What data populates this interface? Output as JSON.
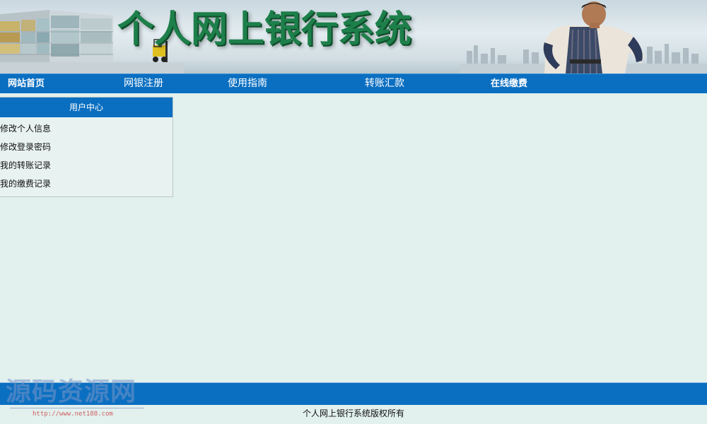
{
  "header": {
    "title": "个人网上银行系统"
  },
  "nav": {
    "items": [
      {
        "label": "网站首页"
      },
      {
        "label": "网银注册"
      },
      {
        "label": "使用指南"
      },
      {
        "label": "转账汇款"
      },
      {
        "label": "在线缴费"
      }
    ]
  },
  "user_center": {
    "title": "用户中心",
    "links": [
      {
        "label": "修改个人信息"
      },
      {
        "label": "修改登录密码"
      },
      {
        "label": "我的转账记录"
      },
      {
        "label": "我的缴费记录"
      }
    ]
  },
  "footer": {
    "copyright": "个人网上银行系统版权所有"
  },
  "watermark": {
    "title": "源码资源网",
    "url": "http://www.net188.com"
  },
  "colors": {
    "nav_blue": "#0b6fc1",
    "page_bg": "#e2f0ee",
    "title_green": "#1d7f4a"
  }
}
